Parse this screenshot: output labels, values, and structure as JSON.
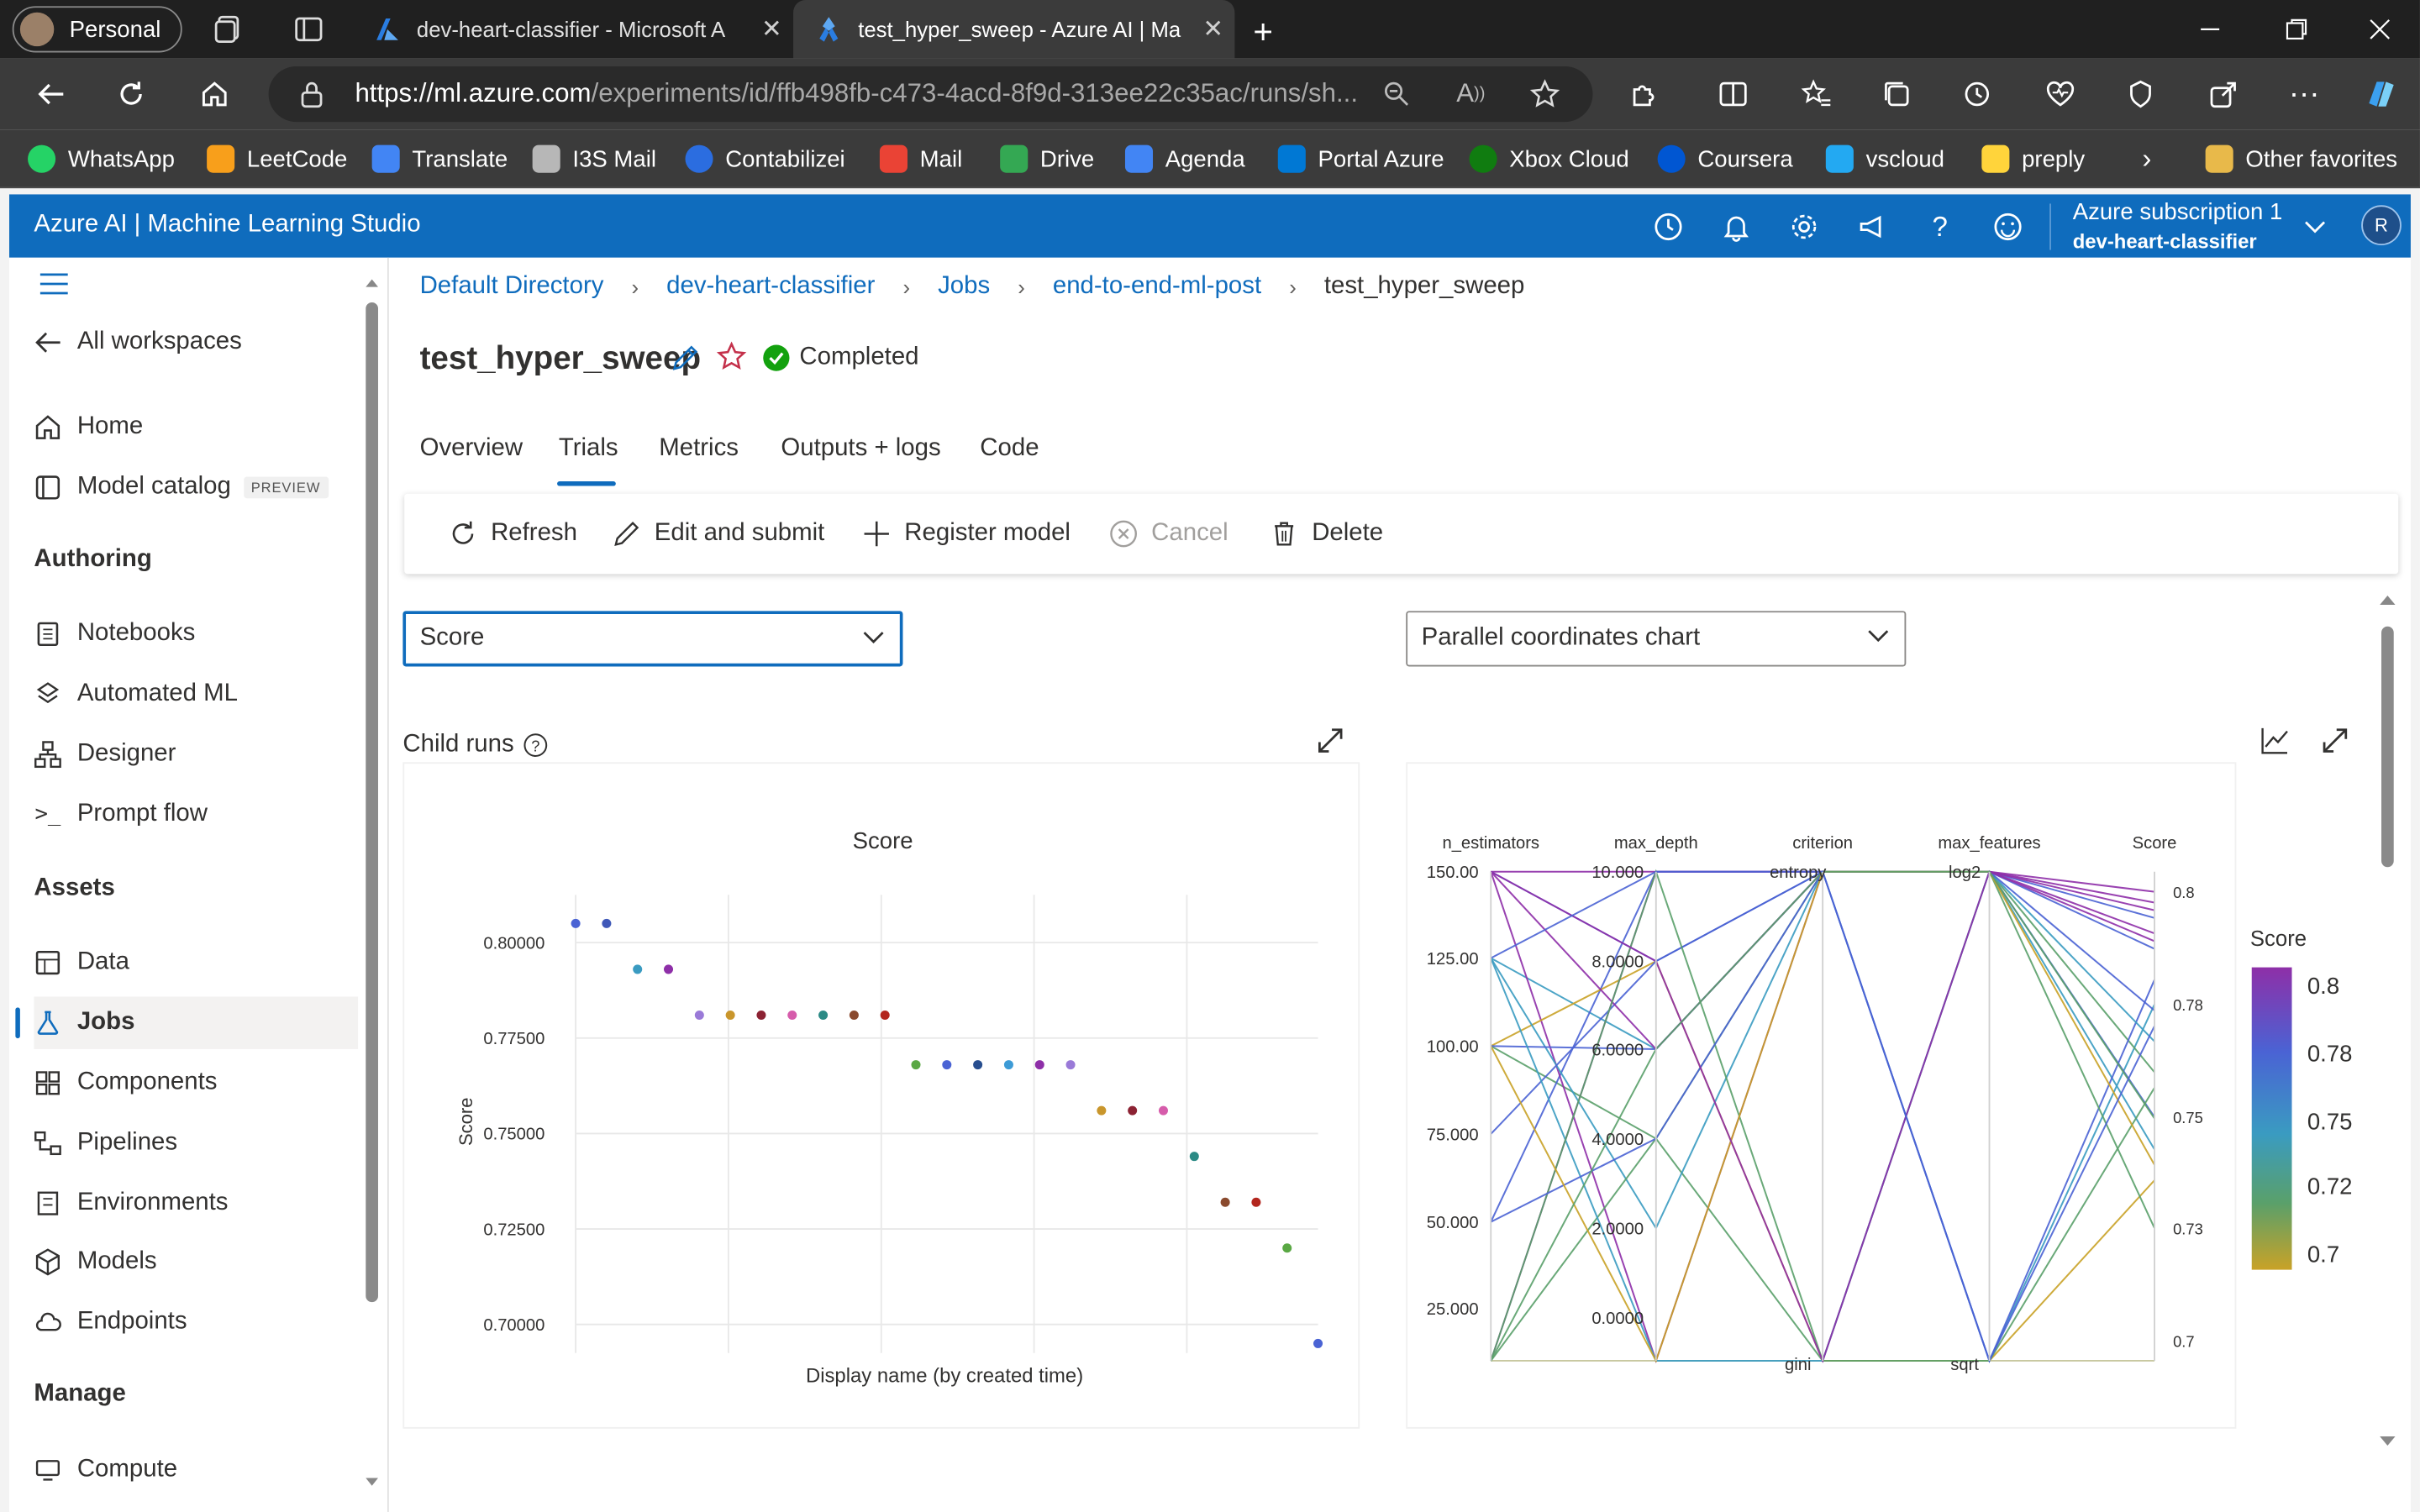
{
  "browser": {
    "profile_label": "Personal",
    "tabs": [
      {
        "title": "dev-heart-classifier - Microsoft A"
      },
      {
        "title": "test_hyper_sweep - Azure AI | Ma"
      }
    ],
    "url_host": "https://ml.azure.com",
    "url_path": "/experiments/id/ffb498fb-c473-4acd-8f9d-313ee22c35ac/runs/sh...",
    "bookmarks": [
      "WhatsApp",
      "LeetCode",
      "Translate",
      "I3S Mail",
      "Contabilizei",
      "Mail",
      "Drive",
      "Agenda",
      "Portal Azure",
      "Xbox Cloud",
      "Coursera",
      "vscloud",
      "preply"
    ],
    "other_favorites": "Other favorites"
  },
  "app": {
    "brand": "Azure AI | Machine Learning Studio",
    "subscription": "Azure subscription 1",
    "workspace": "dev-heart-classifier",
    "avatar": "R",
    "accent": "#0f6cbd"
  },
  "sidebar": {
    "all_workspaces": "All workspaces",
    "home": "Home",
    "model_catalog": "Model catalog",
    "preview_badge": "PREVIEW",
    "authoring_header": "Authoring",
    "authoring": [
      "Notebooks",
      "Automated ML",
      "Designer",
      "Prompt flow"
    ],
    "assets_header": "Assets",
    "assets": [
      "Data",
      "Jobs",
      "Components",
      "Pipelines",
      "Environments",
      "Models",
      "Endpoints"
    ],
    "manage_header": "Manage",
    "manage": [
      "Compute"
    ],
    "selected": "Jobs"
  },
  "breadcrumb": [
    "Default Directory",
    "dev-heart-classifier",
    "Jobs",
    "end-to-end-ml-post",
    "test_hyper_sweep"
  ],
  "job": {
    "name": "test_hyper_sweep",
    "status": "Completed"
  },
  "pivots": [
    "Overview",
    "Trials",
    "Metrics",
    "Outputs + logs",
    "Code"
  ],
  "toolbar": {
    "refresh": "Refresh",
    "edit": "Edit and submit",
    "register": "Register model",
    "cancel": "Cancel",
    "delete": "Delete"
  },
  "metric_select": "Score",
  "chart_select": "Parallel coordinates chart",
  "child_runs_label": "Child runs",
  "chart_data": [
    {
      "type": "scatter",
      "title": "Score",
      "xlabel": "Display name (by created time)",
      "ylabel": "Score",
      "yticks": [
        "0.80000",
        "0.77500",
        "0.75000",
        "0.72500",
        "0.70000"
      ],
      "ylim": [
        0.6925,
        0.8125
      ],
      "points": [
        {
          "x": 1,
          "y": 0.805,
          "color": "#4a63d4"
        },
        {
          "x": 2,
          "y": 0.805,
          "color": "#3f58b8"
        },
        {
          "x": 3,
          "y": 0.793,
          "color": "#3a9bc1"
        },
        {
          "x": 4,
          "y": 0.793,
          "color": "#8e2fa8"
        },
        {
          "x": 5,
          "y": 0.781,
          "color": "#9a7ad8"
        },
        {
          "x": 6,
          "y": 0.781,
          "color": "#c9962c"
        },
        {
          "x": 7,
          "y": 0.781,
          "color": "#8c2233"
        },
        {
          "x": 8,
          "y": 0.781,
          "color": "#d65cab"
        },
        {
          "x": 9,
          "y": 0.781,
          "color": "#2b8a85"
        },
        {
          "x": 10,
          "y": 0.781,
          "color": "#8a4a2e"
        },
        {
          "x": 11,
          "y": 0.781,
          "color": "#b3261e"
        },
        {
          "x": 12,
          "y": 0.768,
          "color": "#5aa844"
        },
        {
          "x": 13,
          "y": 0.768,
          "color": "#4a63d4"
        },
        {
          "x": 14,
          "y": 0.768,
          "color": "#274e8f"
        },
        {
          "x": 15,
          "y": 0.768,
          "color": "#3d9bd6"
        },
        {
          "x": 16,
          "y": 0.768,
          "color": "#8e2fa8"
        },
        {
          "x": 17,
          "y": 0.768,
          "color": "#9a7ad8"
        },
        {
          "x": 18,
          "y": 0.756,
          "color": "#c9962c"
        },
        {
          "x": 19,
          "y": 0.756,
          "color": "#8c2233"
        },
        {
          "x": 20,
          "y": 0.756,
          "color": "#d65cab"
        },
        {
          "x": 21,
          "y": 0.744,
          "color": "#2b8a85"
        },
        {
          "x": 22,
          "y": 0.732,
          "color": "#8a4a2e"
        },
        {
          "x": 23,
          "y": 0.732,
          "color": "#b3261e"
        },
        {
          "x": 24,
          "y": 0.72,
          "color": "#5aa844"
        },
        {
          "x": 25,
          "y": 0.695,
          "color": "#4a63d4"
        }
      ]
    },
    {
      "type": "parallel_coordinates",
      "axes": [
        {
          "name": "n_estimators",
          "ticks": [
            "150.00",
            "125.00",
            "100.00",
            "75.000",
            "50.000",
            "25.000"
          ]
        },
        {
          "name": "max_depth",
          "ticks": [
            "10.000",
            "8.0000",
            "6.0000",
            "4.0000",
            "2.0000",
            "0.0000"
          ]
        },
        {
          "name": "criterion",
          "ticks": [
            "entropy",
            "gini"
          ]
        },
        {
          "name": "max_features",
          "ticks": [
            "log2",
            "sqrt"
          ]
        },
        {
          "name": "Score",
          "ticks": [
            "0.8",
            "0.78",
            "0.75",
            "0.73",
            "0.7"
          ]
        }
      ],
      "colorbar": {
        "title": "Score",
        "ticks": [
          "0.8",
          "0.78",
          "0.75",
          "0.72",
          "0.7"
        ],
        "colors": [
          "#8e2fa8",
          "#4a63d4",
          "#3a9bc1",
          "#5aa06a",
          "#c9a227"
        ]
      }
    }
  ]
}
